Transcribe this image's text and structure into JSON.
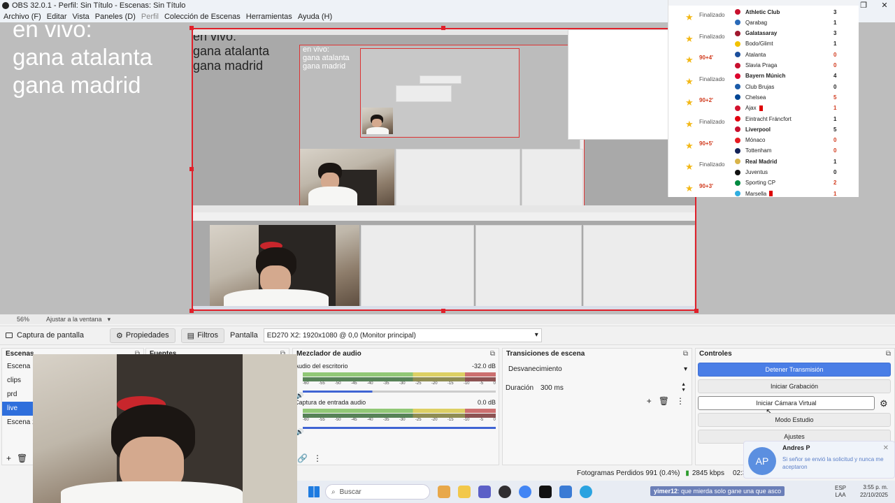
{
  "window": {
    "title": "OBS 32.0.1 - Perfil: Sin Título - Escenas: Sin Título",
    "controls": [
      "—",
      "❐",
      "✕"
    ]
  },
  "menu": [
    "Archivo (F)",
    "Editar",
    "Vista",
    "Paneles (D)",
    "Perfil",
    "Colección de Escenas",
    "Herramientas",
    "Ayuda (H)"
  ],
  "overlay": {
    "line1": "en vivo:",
    "line2": "gana atalanta",
    "line3": "gana madrid"
  },
  "scores": [
    {
      "status": "Finalizado",
      "team": "Athletic Club",
      "score": "3",
      "win": true,
      "red": false
    },
    {
      "status": "",
      "team": "Qarabag",
      "score": "1",
      "win": false,
      "red": false
    },
    {
      "status": "Finalizado",
      "team": "Galatasaray",
      "score": "3",
      "win": true,
      "red": false
    },
    {
      "status": "",
      "team": "Bodo/Glimt",
      "score": "1",
      "win": false,
      "red": false
    },
    {
      "status": "90+4'",
      "team": "Atalanta",
      "score": "0",
      "win": false,
      "red": true
    },
    {
      "status": "",
      "team": "Slavia Praga",
      "score": "0",
      "win": false,
      "red": true
    },
    {
      "status": "Finalizado",
      "team": "Bayern Múnich",
      "score": "4",
      "win": true,
      "red": false
    },
    {
      "status": "",
      "team": "Club Brujas",
      "score": "0",
      "win": false,
      "red": false
    },
    {
      "status": "90+2'",
      "team": "Chelsea",
      "score": "5",
      "win": false,
      "red": true
    },
    {
      "status": "",
      "team": "Ajax",
      "score": "1",
      "win": false,
      "red": true,
      "card": true
    },
    {
      "status": "Finalizado",
      "team": "Eintracht Fráncfort",
      "score": "1",
      "win": false,
      "red": false
    },
    {
      "status": "",
      "team": "Liverpool",
      "score": "5",
      "win": true,
      "red": false
    },
    {
      "status": "90+5'",
      "team": "Mónaco",
      "score": "0",
      "win": false,
      "red": true
    },
    {
      "status": "",
      "team": "Tottenham",
      "score": "0",
      "win": false,
      "red": true
    },
    {
      "status": "Finalizado",
      "team": "Real Madrid",
      "score": "1",
      "win": true,
      "red": false
    },
    {
      "status": "",
      "team": "Juventus",
      "score": "0",
      "win": false,
      "red": false
    },
    {
      "status": "90+3'",
      "team": "Sporting CP",
      "score": "2",
      "win": false,
      "red": true
    },
    {
      "status": "",
      "team": "Marsella",
      "score": "1",
      "win": false,
      "red": true,
      "card": true
    }
  ],
  "zoom": {
    "level": "56%",
    "fit": "Ajustar a la ventana"
  },
  "source_toolbar": {
    "source_name": "Captura de pantalla",
    "properties": "Propiedades",
    "filters": "Filtros",
    "display_label": "Pantalla",
    "display_value": "ED270 X2: 1920x1080 @ 0,0 (Monitor principal)"
  },
  "scenes": {
    "title": "Escenas",
    "items": [
      "Escena",
      "clips",
      "prd",
      "live",
      "Escena 2"
    ],
    "active_index": 3
  },
  "sources": {
    "title": "Fuentes"
  },
  "mixer": {
    "title": "Mezclador de audio",
    "tracks": [
      {
        "name": "Audio del escritorio",
        "db": "-32.0 dB"
      },
      {
        "name": "Captura de entrada audio",
        "db": "0.0 dB"
      }
    ],
    "ticks": [
      "-60",
      "-55",
      "-50",
      "-45",
      "-40",
      "-35",
      "-30",
      "-25",
      "-20",
      "-15",
      "-10",
      "-5",
      "0"
    ]
  },
  "transitions": {
    "title": "Transiciones de escena",
    "selected": "Desvanecimiento",
    "duration_label": "Duración",
    "duration_value": "300 ms"
  },
  "controls": {
    "title": "Controles",
    "stop_stream": "Detener Transmisión",
    "start_recording": "Iniciar Grabación",
    "virtual_cam": "Iniciar Cámara Virtual",
    "studio_mode": "Modo Estudio",
    "settings": "Ajustes"
  },
  "status": {
    "dropped": "Fotogramas Perdidos 991 (0.4%)",
    "bitrate": "2845 kbps",
    "time": "02:3"
  },
  "notification": {
    "initials": "AP",
    "name": "Andres P",
    "message": "Si señor se envió la solicitud y nunca me aceptaron"
  },
  "taskbar": {
    "search": "Buscar",
    "chat_user": "yimer12",
    "chat_msg": ": que mierda solo gane una que asco",
    "lang1": "ESP",
    "lang2": "LAA",
    "time": "3:55 p. m.",
    "date": "22/10/2025"
  },
  "colors": {
    "accent": "#2f6fdc",
    "stream_button": "#4a7ee6",
    "selection_red": "#e0202a",
    "star": "#f3b816",
    "live_minute": "#d13a1d"
  }
}
